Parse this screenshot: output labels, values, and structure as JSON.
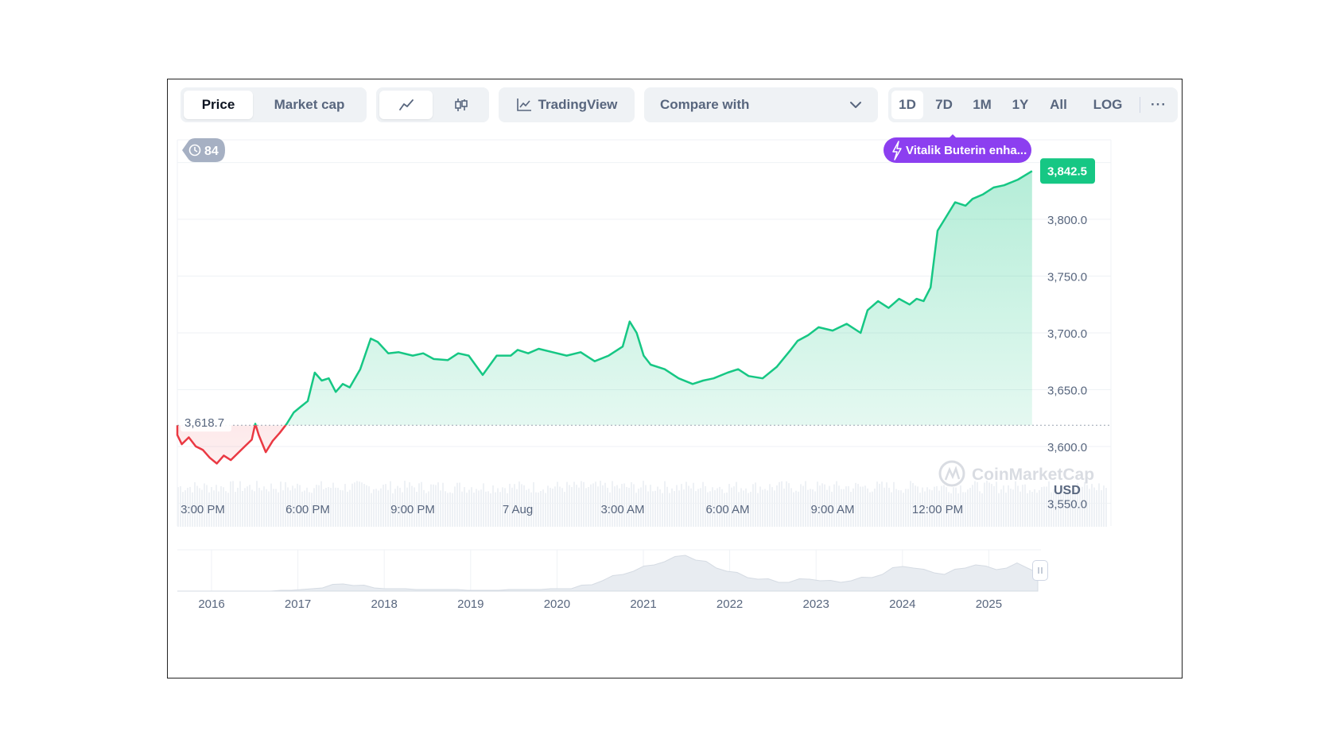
{
  "toolbar": {
    "price_label": "Price",
    "market_cap_label": "Market cap",
    "tradingview_label": "TradingView",
    "compare_label": "Compare with",
    "ranges": [
      "1D",
      "7D",
      "1M",
      "1Y",
      "All"
    ],
    "log_label": "LOG",
    "more_label": "···",
    "active_metric": "Price",
    "active_range": "1D",
    "active_chart_style": "line"
  },
  "badges": {
    "history_count": "84",
    "news_label": "Vitalik Buterin enha...",
    "current_price": "3,842.5",
    "open_price": "3,618.7"
  },
  "watermark": "CoinMarketCap",
  "colors": {
    "up": "#16c784",
    "down": "#ea3943",
    "news": "#8c3ff0",
    "axis_text": "#58667e"
  },
  "chart_data": {
    "type": "line",
    "currency": "USD",
    "x_labels": [
      "3:00 PM",
      "6:00 PM",
      "9:00 PM",
      "7 Aug",
      "3:00 AM",
      "6:00 AM",
      "9:00 AM",
      "12:00 PM"
    ],
    "y_ticks": [
      "3,800.0",
      "3,750.0",
      "3,700.0",
      "3,650.0",
      "3,600.0",
      "3,550.0"
    ],
    "ylim": [
      3530,
      3870
    ],
    "baseline": 3618.7,
    "current": 3842.5,
    "hours_from_3pm": [
      -1,
      -0.8,
      -0.6,
      -0.4,
      -0.2,
      0,
      0.2,
      0.4,
      0.6,
      0.8,
      1.0,
      1.2,
      1.4,
      1.5,
      1.6,
      1.8,
      2.0,
      2.2,
      2.4,
      2.6,
      2.8,
      3.0,
      3.2,
      3.4,
      3.6,
      3.8,
      4.0,
      4.2,
      4.5,
      4.8,
      5.0,
      5.3,
      5.6,
      6.0,
      6.3,
      6.6,
      7.0,
      7.3,
      7.6,
      8.0,
      8.4,
      8.8,
      9.0,
      9.3,
      9.6,
      10.0,
      10.4,
      10.8,
      11.2,
      11.6,
      12.0,
      12.2,
      12.4,
      12.5,
      12.6,
      12.8,
      13.2,
      13.6,
      14.0,
      14.3,
      14.6,
      15.0,
      15.3,
      15.6,
      16.0,
      16.4,
      16.8,
      17.0,
      17.3,
      17.6,
      18.0,
      18.4,
      18.8,
      19.0,
      19.3,
      19.6,
      19.9,
      20.2,
      20.4,
      20.6,
      20.8,
      21.0,
      21.2,
      21.5,
      21.8,
      22.0,
      22.3,
      22.6,
      22.9,
      23.3,
      23.7
    ],
    "prices": [
      3618.7,
      3610,
      3602,
      3608,
      3600,
      3597,
      3590,
      3585,
      3592,
      3588,
      3594,
      3600,
      3606,
      3620,
      3610,
      3595,
      3605,
      3612,
      3620,
      3630,
      3635,
      3640,
      3665,
      3658,
      3660,
      3648,
      3655,
      3652,
      3668,
      3695,
      3692,
      3682,
      3683,
      3680,
      3682,
      3677,
      3676,
      3682,
      3680,
      3663,
      3680,
      3680,
      3685,
      3682,
      3686,
      3683,
      3680,
      3683,
      3675,
      3680,
      3688,
      3710,
      3700,
      3690,
      3680,
      3672,
      3668,
      3660,
      3655,
      3658,
      3660,
      3665,
      3668,
      3662,
      3660,
      3670,
      3685,
      3693,
      3698,
      3705,
      3702,
      3708,
      3700,
      3720,
      3728,
      3722,
      3730,
      3725,
      3730,
      3728,
      3740,
      3790,
      3800,
      3815,
      3812,
      3818,
      3822,
      3828,
      3830,
      3835,
      3842.5
    ],
    "navigator_years": [
      "2016",
      "2017",
      "2018",
      "2019",
      "2020",
      "2021",
      "2022",
      "2023",
      "2024",
      "2025"
    ]
  }
}
